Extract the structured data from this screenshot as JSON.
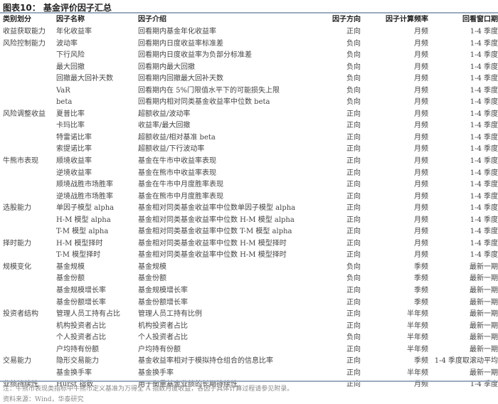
{
  "title": "图表10： 基金评价因子汇总",
  "headers": [
    "类别划分",
    "因子名称",
    "因子介绍",
    "因子方向",
    "因子计算频率",
    "回看窗口期"
  ],
  "rows": [
    [
      "收益获取能力",
      "年化收益率",
      "回看期内基金年化收益率",
      "正向",
      "月频",
      "1-4 季度"
    ],
    [
      "风险控制能力",
      "波动率",
      "回看期内日度收益率标准差",
      "负向",
      "月频",
      "1-4 季度"
    ],
    [
      "",
      "下行风险",
      "回看期内日度收益率为负部分标准差",
      "负向",
      "月频",
      "1-4 季度"
    ],
    [
      "",
      "最大回撤",
      "回看期内最大回撤",
      "负向",
      "月频",
      "1-4 季度"
    ],
    [
      "",
      "回撤最大回补天数",
      "回看期内回撤最大回补天数",
      "负向",
      "月频",
      "1-4 季度"
    ],
    [
      "",
      "VaR",
      "回看期内在 5%门限值水平下的可能损失上限",
      "负向",
      "月频",
      "1-4 季度"
    ],
    [
      "",
      "beta",
      "回看期内相对同类基金收益率中位数 beta",
      "负向",
      "月频",
      "1-4 季度"
    ],
    [
      "风险调整收益",
      "夏普比率",
      "超额收益/波动率",
      "正向",
      "月频",
      "1-4 季度"
    ],
    [
      "",
      "卡玛比率",
      "收益率/最大回撤",
      "正向",
      "月频",
      "1-4 季度"
    ],
    [
      "",
      "特雷诺比率",
      "超额收益/相对基准 beta",
      "正向",
      "月频",
      "1-4 季度"
    ],
    [
      "",
      "索提诺比率",
      "超额收益/下行波动率",
      "正向",
      "月频",
      "1-4 季度"
    ],
    [
      "牛熊市表现",
      "顺境收益率",
      "基金在牛市中收益率表现",
      "正向",
      "月频",
      "1-4 季度"
    ],
    [
      "",
      "逆境收益率",
      "基金在熊市中收益率表现",
      "正向",
      "月频",
      "1-4 季度"
    ],
    [
      "",
      "顺境战胜市场胜率",
      "基金在牛市中月度胜率表现",
      "正向",
      "月频",
      "1-4 季度"
    ],
    [
      "",
      "逆境战胜市场胜率",
      "基金在熊市中月度胜率表现",
      "正向",
      "月频",
      "1-4 季度"
    ],
    [
      "选股能力",
      "单因子模型 alpha",
      "基金相对同类基金收益率中位数单因子模型 alpha",
      "正向",
      "月频",
      "1-4 季度"
    ],
    [
      "",
      "H-M 模型 alpha",
      "基金相对同类基金收益率中位数 H-M 模型 alpha",
      "正向",
      "月频",
      "1-4 季度"
    ],
    [
      "",
      "T-M 模型 alpha",
      "基金相对同类基金收益率中位数 T-M 模型 alpha",
      "正向",
      "月频",
      "1-4 季度"
    ],
    [
      "择时能力",
      "H-M 模型择时",
      "基金相对同类基金收益率中位数 H-M 模型择时",
      "正向",
      "月频",
      "1-4 季度"
    ],
    [
      "",
      "T-M 模型择时",
      "基金相对同类基金收益率中位数 H-M 模型择时",
      "正向",
      "月频",
      "1-4 季度"
    ],
    [
      "规模变化",
      "基金规模",
      "基金规模",
      "负向",
      "季频",
      "最新一期"
    ],
    [
      "",
      "基金份额",
      "基金份额",
      "负向",
      "季频",
      "最新一期"
    ],
    [
      "",
      "基金规模增长率",
      "基金规模增长率",
      "正向",
      "季频",
      "最新一期"
    ],
    [
      "",
      "基金份额增长率",
      "基金份额增长率",
      "正向",
      "季频",
      "最新一期"
    ],
    [
      "投资者结构",
      "管理人员工持有占比",
      "管理人员工持有比例",
      "正向",
      "半年频",
      "最新一期"
    ],
    [
      "",
      "机构投资者占比",
      "机构投资者占比",
      "正向",
      "半年频",
      "最新一期"
    ],
    [
      "",
      "个人投资者占比",
      "个人投资者占比",
      "负向",
      "半年频",
      "最新一期"
    ],
    [
      "",
      "户均持有份额",
      "户均持有份额",
      "正向",
      "半年频",
      "最新一期"
    ],
    [
      "交易能力",
      "隐形交易能力",
      "基金收益率相对于模拟持仓组合的信息比率",
      "正向",
      "季频",
      "1-4 季度取滚动平均"
    ],
    [
      "",
      "基金换手率",
      "基金换手率",
      "正向",
      "半年频",
      "最新一期"
    ],
    [
      "业绩持续性",
      "Hurst 指数",
      "用于衡量基金业绩的长期持续性",
      "正向",
      "月频",
      "1-4 季度"
    ]
  ],
  "note": "注：牛熊市表现类指标中牛熊市定义基准为万得全 A 指数月度收益，各因子具体计算过程请参见附录。",
  "source": "资料来源：Wind，华泰研究"
}
